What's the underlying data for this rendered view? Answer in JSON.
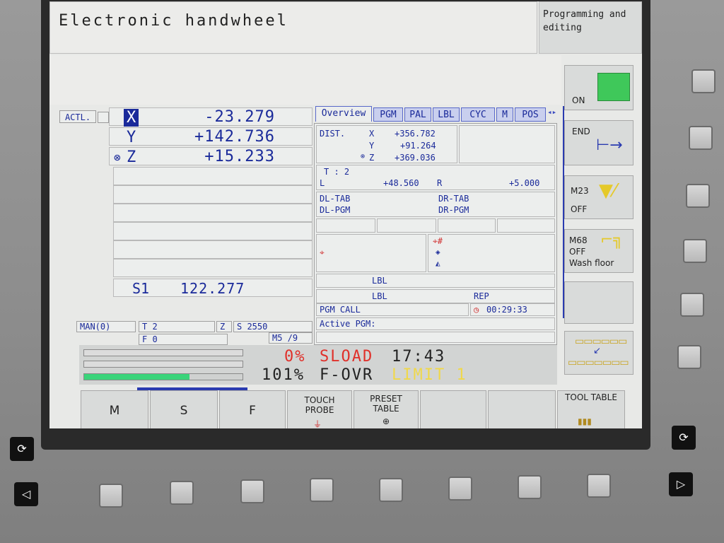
{
  "title": "Electronic handwheel",
  "mode": "Programming and editing",
  "position_display": {
    "actl_label": "ACTL.",
    "axes": [
      {
        "name": "X",
        "value": "-23.279"
      },
      {
        "name": "Y",
        "value": "+142.736"
      },
      {
        "name": "Z",
        "value": "+15.233"
      }
    ],
    "spindle": {
      "name": "S1",
      "value": "122.277"
    }
  },
  "status_line": {
    "mode": "MAN(0)",
    "tool": "T 2",
    "axis": "Z",
    "speed": "S 2550",
    "feed": "F 0",
    "m_func": "M5 /9"
  },
  "tabs": [
    "Overview",
    "PGM",
    "PAL",
    "LBL",
    "CYC",
    "M",
    "POS"
  ],
  "overview": {
    "dist_label": "DIST.",
    "dist": [
      {
        "axis": "X",
        "value": "+356.782"
      },
      {
        "axis": "Y",
        "value": "+91.264"
      },
      {
        "axis": "Z",
        "value": "+369.036"
      }
    ],
    "tool_label": "T : 2",
    "l_label": "L",
    "l_value": "+48.560",
    "r_label": "R",
    "r_value": "+5.000",
    "dl_tab": "DL-TAB",
    "dl_pgm": "DL-PGM",
    "dr_tab": "DR-TAB",
    "dr_pgm": "DR-PGM",
    "lbl1": "LBL",
    "lbl2": "LBL",
    "rep": "REP",
    "pgm_call": "PGM CALL",
    "time": "00:29:33",
    "active_pgm": "Active PGM:"
  },
  "load": {
    "sload_pct": "0%",
    "sload_label": "SLOAD",
    "clock": "17:43",
    "fovr_pct": "101%",
    "fovr_label": "F-OVR",
    "limit": "LIMIT 1"
  },
  "softkeys": [
    "M",
    "S",
    "F",
    "TOUCH PROBE",
    "PRESET TABLE",
    "",
    "",
    "TOOL TABLE"
  ],
  "vertical_softkeys": {
    "on": "ON",
    "end": "END",
    "m23_code": "M23",
    "m23_state": "OFF",
    "m68_code": "M68",
    "m68_state": "OFF",
    "m68_desc": "Wash floor"
  },
  "colors": {
    "screen_bg": "#e8e9e7",
    "text_blue": "#1a2a9a",
    "sload_red": "#e0302a",
    "limit_yellow": "#f0d84a",
    "load_green": "#3ad47a"
  }
}
